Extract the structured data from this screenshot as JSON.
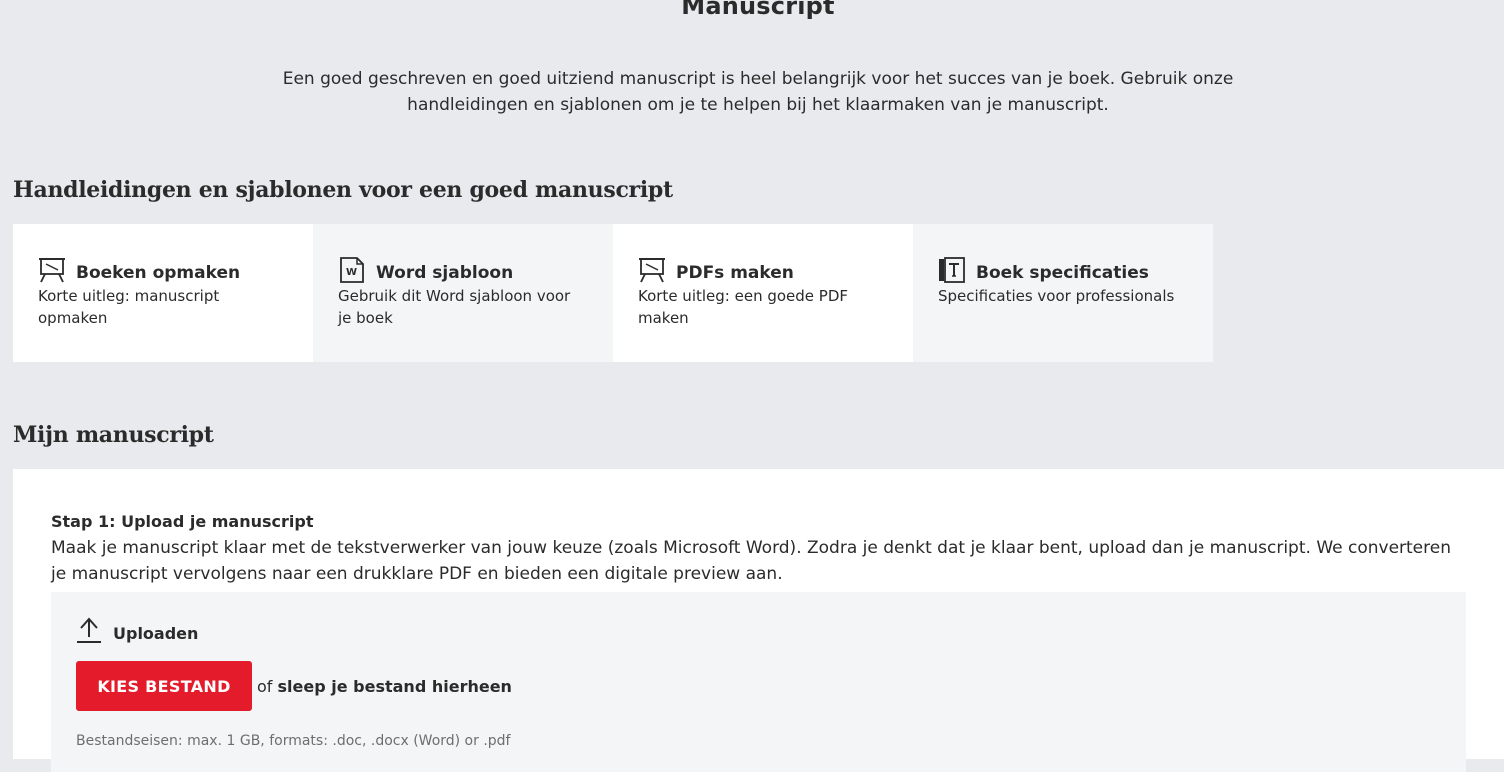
{
  "page": {
    "title": "Manuscript",
    "intro": "Een goed geschreven en goed uitziend manuscript is heel belangrijk voor het succes van je boek. Gebruik onze handleidingen en sjablonen om je te helpen bij het klaarmaken van je manuscript."
  },
  "guides": {
    "heading": "Handleidingen en sjablonen voor een goed manuscript",
    "cards": [
      {
        "title": "Boeken opmaken",
        "description": "Korte uitleg: manuscript opmaken",
        "icon": "presentation-icon"
      },
      {
        "title": "Word sjabloon",
        "description": "Gebruik dit Word sjabloon voor je boek",
        "icon": "word-document-icon"
      },
      {
        "title": "PDFs maken",
        "description": "Korte uitleg: een goede PDF maken",
        "icon": "presentation-icon"
      },
      {
        "title": "Boek specificaties",
        "description": "Specificaties voor professionals",
        "icon": "book-ruler-icon"
      }
    ]
  },
  "manuscript": {
    "heading": "Mijn manuscript",
    "step_title": "Stap 1: Upload je manuscript",
    "step_text": "Maak je manuscript klaar met de tekstverwerker van jouw keuze (zoals Microsoft Word). Zodra je denkt dat je klaar bent, upload dan je manuscript. We converteren je manuscript vervolgens naar een drukklare PDF en bieden een digitale preview aan.",
    "upload": {
      "label": "Uploaden",
      "icon": "upload-arrow-icon",
      "button_label": "KIES BESTAND",
      "or_text": "of",
      "drag_text": "sleep je bestand hierheen",
      "requirements": "Bestandseisen: max. 1 GB, formats: .doc, .docx (Word) or .pdf"
    }
  },
  "colors": {
    "background": "#e9eaed",
    "accent": "#e31b2a",
    "card_white": "#ffffff",
    "card_grey": "#f4f5f6"
  }
}
